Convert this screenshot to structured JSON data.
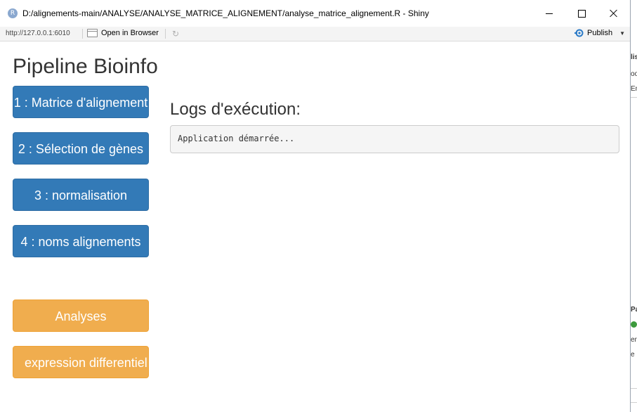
{
  "window": {
    "app_icon_letter": "R",
    "title": "D:/alignements-main/ANALYSE/ANALYSE_MATRICE_ALIGNEMENT/analyse_matrice_alignement.R - Shiny"
  },
  "toolbar": {
    "url": "http://127.0.0.1:6010",
    "open_in_browser": "Open in Browser",
    "publish": "Publish"
  },
  "page": {
    "title": "Pipeline Bioinfo",
    "buttons": [
      {
        "label": "1 : Matrice d'alignement",
        "color": "#337ab7"
      },
      {
        "label": "2 : Sélection de gènes",
        "color": "#337ab7"
      },
      {
        "label": "3 : normalisation",
        "color": "#337ab7"
      },
      {
        "label": "4 : noms alignements",
        "color": "#337ab7"
      },
      {
        "label": "Analyses",
        "color": "#f0ad4e"
      },
      {
        "label": "expression differentielle",
        "color": "#f0ad4e"
      }
    ],
    "logs_title": "Logs d'exécution:",
    "log_text": "Application démarrée..."
  },
  "background": {
    "fragments": [
      "lis",
      "oo",
      "En",
      "Pa",
      "en",
      "e"
    ]
  }
}
